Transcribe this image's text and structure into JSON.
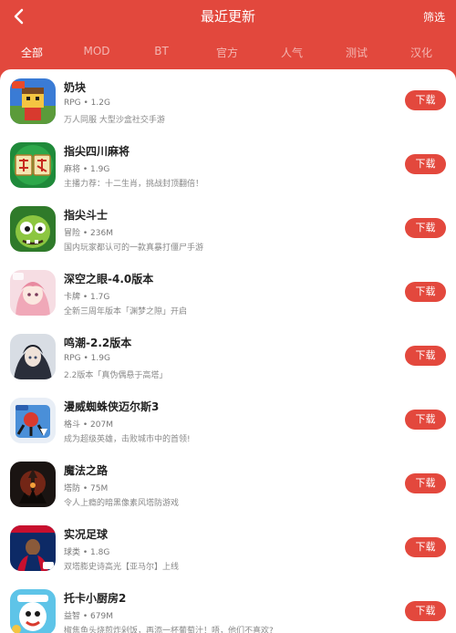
{
  "header": {
    "title": "最近更新",
    "filter_label": "筛选"
  },
  "tabs": [
    {
      "label": "全部",
      "active": true
    },
    {
      "label": "MOD",
      "active": false
    },
    {
      "label": "BT",
      "active": false
    },
    {
      "label": "官方",
      "active": false
    },
    {
      "label": "人气",
      "active": false
    },
    {
      "label": "测试",
      "active": false
    },
    {
      "label": "汉化",
      "active": false
    }
  ],
  "apps": [
    {
      "name": "奶块",
      "meta": "RPG • 1.2G",
      "desc": "万人同服 大型沙盒社交手游",
      "download_label": "下载",
      "icon": "naikuai-icon"
    },
    {
      "name": "指尖四川麻将",
      "meta": "麻将 • 1.9G",
      "desc": "主播力荐：十二生肖，挑战封顶翻倍！",
      "download_label": "下载",
      "icon": "mahjong-icon"
    },
    {
      "name": "指尖斗士",
      "meta": "冒险 • 236M",
      "desc": "国内玩家都认可的一款真暴打僵尸手游",
      "download_label": "下载",
      "icon": "zombie-icon"
    },
    {
      "name": "深空之眼-4.0版本",
      "meta": "卡牌 • 1.7G",
      "desc": "全新三周年版本「渊梦之隙」开启",
      "download_label": "下载",
      "icon": "anime-girl-icon"
    },
    {
      "name": "鸣潮-2.2版本",
      "meta": "RPG • 1.9G",
      "desc": "2.2版本「真伪偶悬于高塔」",
      "download_label": "下载",
      "icon": "wuthering-icon"
    },
    {
      "name": "漫威蜘蛛侠迈尔斯3",
      "meta": "格斗 • 207M",
      "desc": "成为超级英雄，击败城市中的首领!",
      "download_label": "下载",
      "icon": "spiderman-icon"
    },
    {
      "name": "魔法之路",
      "meta": "塔防 • 75M",
      "desc": "令人上瘾的暗黑像素风塔防游戏",
      "download_label": "下载",
      "icon": "dark-castle-icon"
    },
    {
      "name": "实况足球",
      "meta": "球类 • 1.8G",
      "desc": "双塔膨史诗高光【亚马尔】上线",
      "download_label": "下载",
      "icon": "efootball-icon"
    },
    {
      "name": "托卡小厨房2",
      "meta": "益智 • 679M",
      "desc": "椒焦鱼头烧煎炸剁饭，再添一杯葡萄汁！唔，他们不喜欢?",
      "download_label": "下载",
      "icon": "toca-kitchen-icon"
    }
  ],
  "colors": {
    "brand": "#e2483d",
    "button": "#e3483d"
  }
}
